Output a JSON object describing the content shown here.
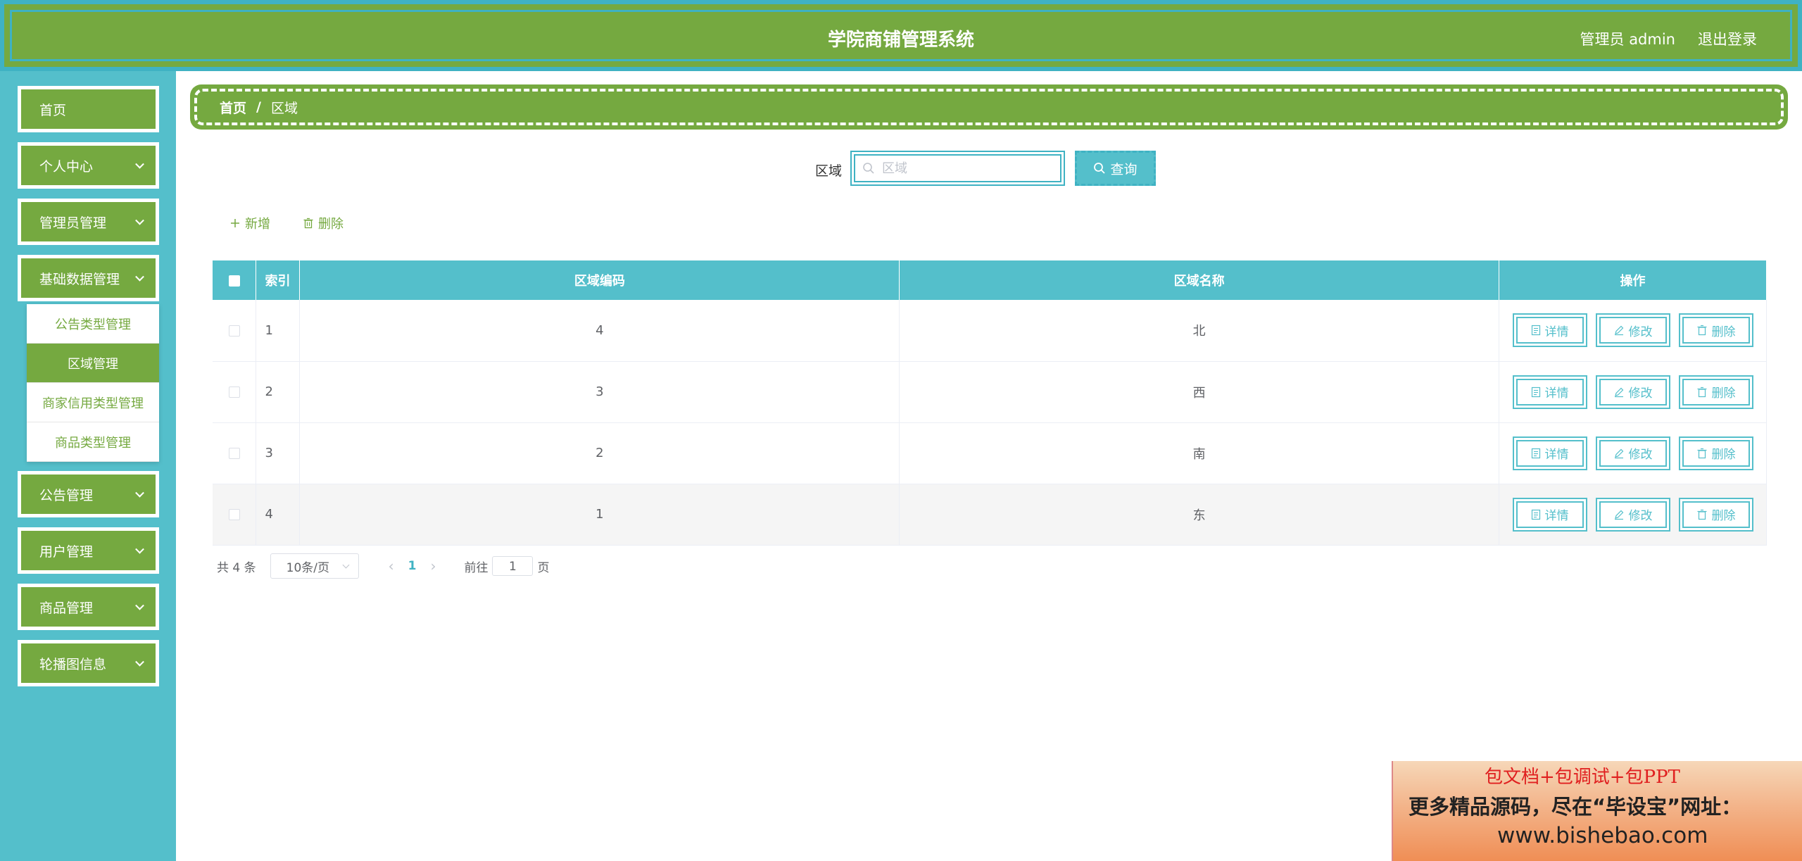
{
  "header": {
    "title": "学院商铺管理系统",
    "user": "管理员 admin",
    "logout": "退出登录"
  },
  "sidebar": {
    "items": [
      {
        "label": "首页",
        "has_arrow": false
      },
      {
        "label": "个人中心",
        "has_arrow": true
      },
      {
        "label": "管理员管理",
        "has_arrow": true
      },
      {
        "label": "基础数据管理",
        "has_arrow": true
      },
      {
        "label": "公告管理",
        "has_arrow": true
      },
      {
        "label": "用户管理",
        "has_arrow": true
      },
      {
        "label": "商品管理",
        "has_arrow": true
      },
      {
        "label": "轮播图信息",
        "has_arrow": true
      }
    ],
    "submenu": [
      {
        "label": "公告类型管理",
        "active": false
      },
      {
        "label": "区域管理",
        "active": true
      },
      {
        "label": "商家信用类型管理",
        "active": false
      },
      {
        "label": "商品类型管理",
        "active": false
      }
    ]
  },
  "breadcrumb": {
    "home": "首页",
    "separator": "/",
    "current": "区域"
  },
  "search": {
    "label": "区域",
    "placeholder": "区域",
    "value": "",
    "button": "查询"
  },
  "toolbar": {
    "add": "新增",
    "delete": "删除"
  },
  "table": {
    "headers": {
      "index": "索引",
      "code": "区域编码",
      "name": "区域名称",
      "ops": "操作"
    },
    "rows": [
      {
        "index": "1",
        "code": "4",
        "name": "北"
      },
      {
        "index": "2",
        "code": "3",
        "name": "西"
      },
      {
        "index": "3",
        "code": "2",
        "name": "南"
      },
      {
        "index": "4",
        "code": "1",
        "name": "东"
      }
    ],
    "actions": {
      "detail": "详情",
      "edit": "修改",
      "delete": "删除"
    }
  },
  "pagination": {
    "total": "共 4 条",
    "page_size": "10条/页",
    "current_page": "1",
    "goto_prefix": "前往",
    "goto_value": "1",
    "goto_suffix": "页"
  },
  "ad": {
    "line1": "包文档+包调试+包PPT",
    "line2": "更多精品源码，尽在“毕设宝”网址：",
    "line3": "www.bishebao.com"
  },
  "colors": {
    "green": "#75a940",
    "teal": "#54bfcb",
    "teal_dark": "#3fb2c3"
  }
}
